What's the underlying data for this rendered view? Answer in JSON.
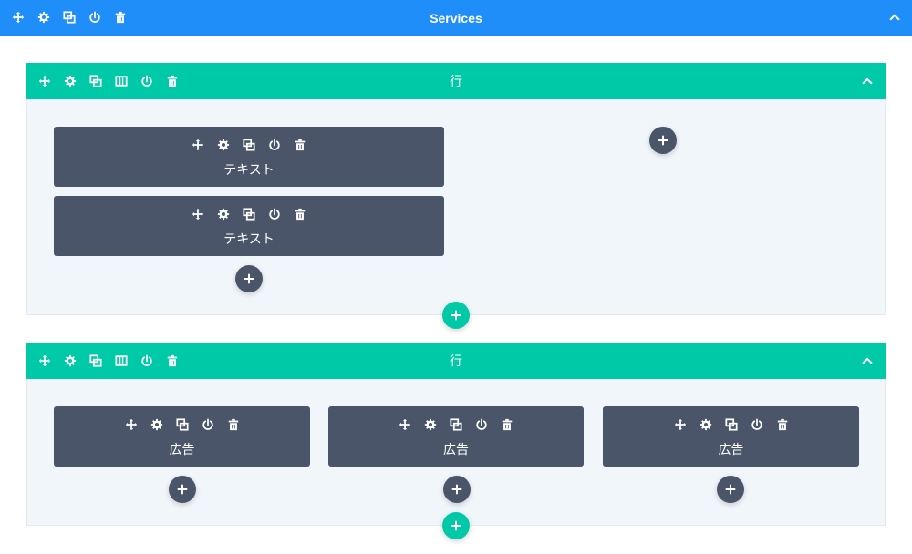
{
  "section": {
    "title": "Services",
    "color": "#1f8ef8",
    "tools": [
      "move-icon",
      "gear-icon",
      "duplicate-icon",
      "power-icon",
      "trash-icon"
    ],
    "collapse_icon": "chevron-up-icon"
  },
  "rows": [
    {
      "title": "行",
      "color": "#00c9a7",
      "tools": [
        "move-icon",
        "gear-icon",
        "duplicate-icon",
        "columns-icon",
        "power-icon",
        "trash-icon"
      ],
      "columns": [
        {
          "modules": [
            {
              "label": "テキスト"
            },
            {
              "label": "テキスト"
            }
          ]
        },
        {
          "modules": []
        }
      ]
    },
    {
      "title": "行",
      "color": "#00c9a7",
      "tools": [
        "move-icon",
        "gear-icon",
        "duplicate-icon",
        "columns-icon",
        "power-icon",
        "trash-icon"
      ],
      "columns": [
        {
          "modules": [
            {
              "label": "広告"
            }
          ]
        },
        {
          "modules": [
            {
              "label": "広告"
            }
          ]
        },
        {
          "modules": [
            {
              "label": "広告"
            }
          ]
        }
      ]
    }
  ],
  "module_tools": [
    "move-icon",
    "gear-icon",
    "duplicate-icon",
    "power-icon",
    "trash-icon"
  ],
  "colors": {
    "module_bg": "#4a5569",
    "row_body_bg": "#f1f6fb",
    "add_module": "#4a5569",
    "add_row": "#00c9a7"
  }
}
